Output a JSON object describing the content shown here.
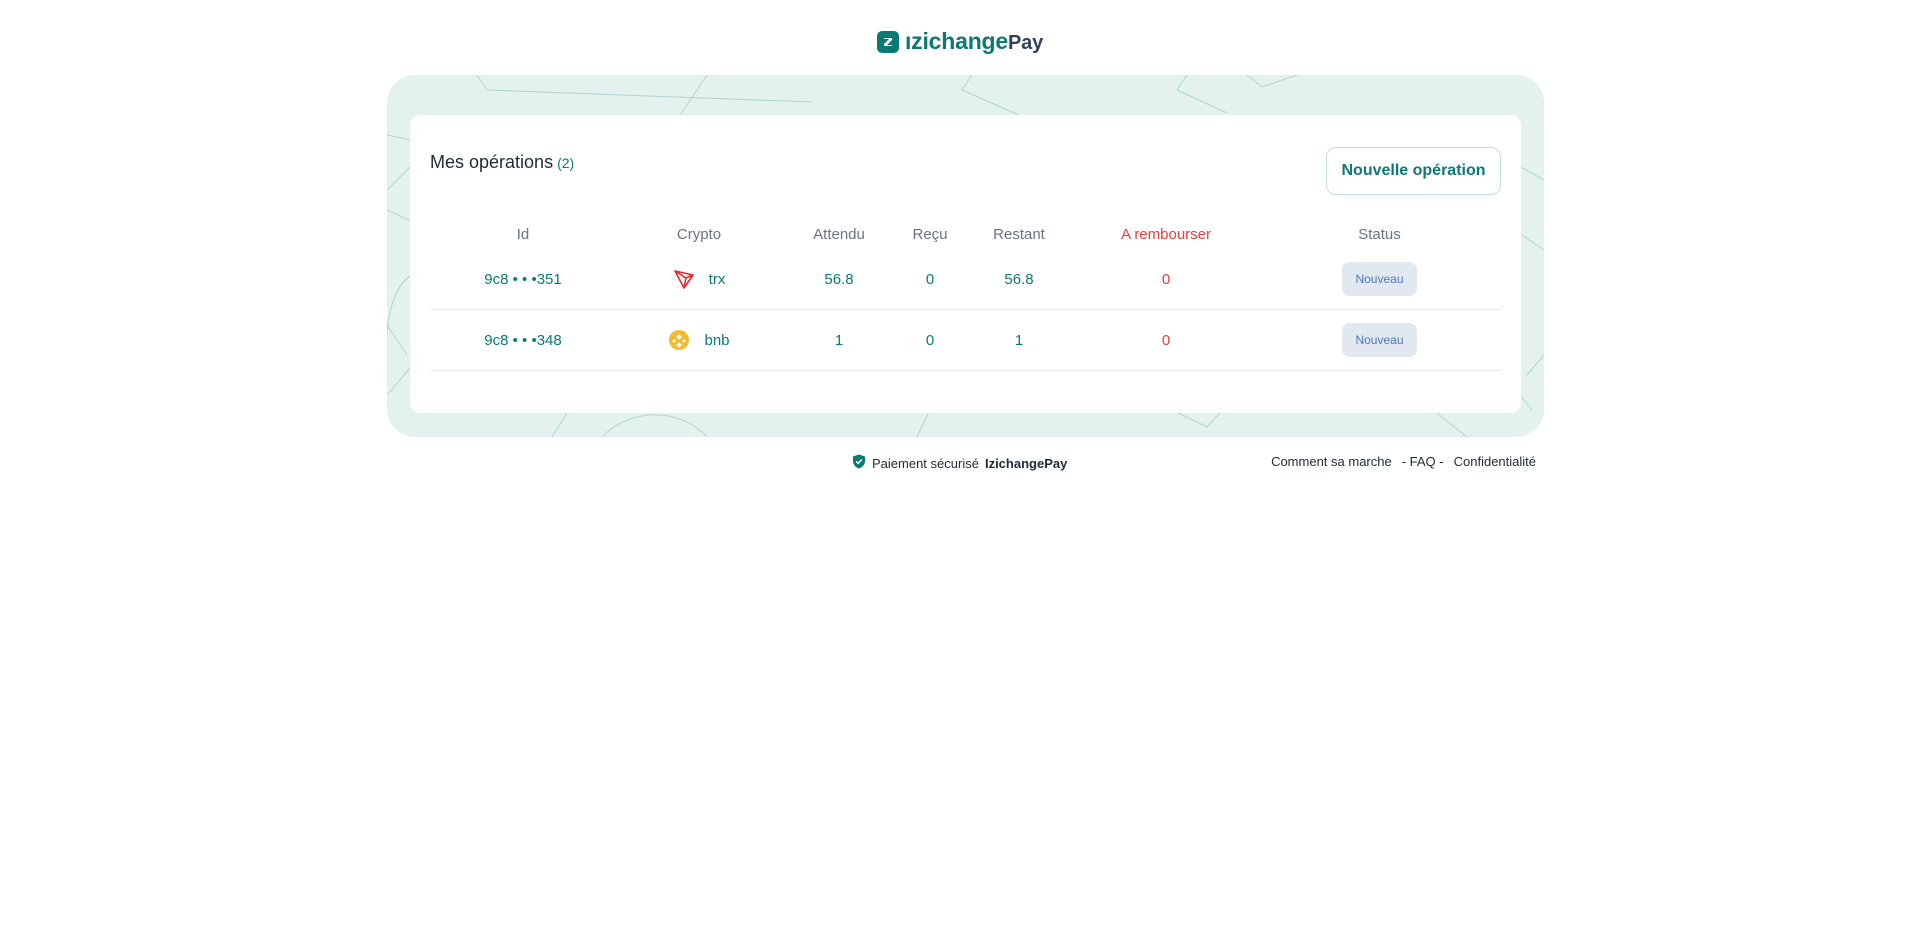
{
  "brand": {
    "izi": "ızichange",
    "pay": "Pay"
  },
  "operations": {
    "title": "Mes opérations",
    "count": "(2)",
    "new_button": "Nouvelle opération",
    "columns": {
      "id": "Id",
      "crypto": "Crypto",
      "attendu": "Attendu",
      "recu": "Reçu",
      "restant": "Restant",
      "rembourser": "A rembourser",
      "status": "Status"
    },
    "rows": [
      {
        "id": "9c8 • • •351",
        "crypto": "trx",
        "icon": "tron-icon",
        "attendu": "56.8",
        "recu": "0",
        "restant": "56.8",
        "rembourser": "0",
        "status": "Nouveau"
      },
      {
        "id": "9c8 • • •348",
        "crypto": "bnb",
        "icon": "bnb-icon",
        "attendu": "1",
        "recu": "0",
        "restant": "1",
        "rembourser": "0",
        "status": "Nouveau"
      }
    ]
  },
  "footer": {
    "secure_text": "Paiement sécurisé",
    "secure_brand": "IzichangePay",
    "link_how": "Comment sa marche",
    "link_faq": "- FAQ -",
    "link_privacy": "Confidentialité"
  },
  "colors": {
    "accent": "#0b7a75",
    "danger": "#ef3b3b",
    "frame_bg": "#e3f1ef",
    "badge_bg": "#e2e8f0",
    "badge_text": "#4a78c2"
  }
}
